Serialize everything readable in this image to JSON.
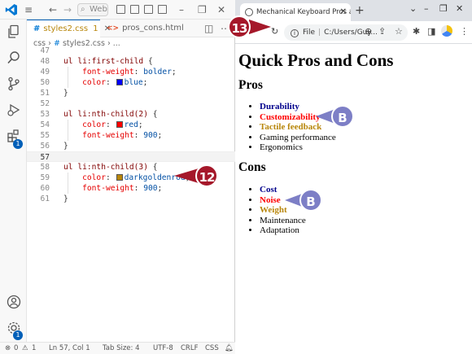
{
  "vscode": {
    "search_text": "Web...",
    "tabs": [
      {
        "icon": "#",
        "label": "styles2.css",
        "count": "1"
      },
      {
        "icon": "<>",
        "label": "pros_cons.html"
      }
    ],
    "breadcrumb": [
      "css",
      "#",
      "styles2.css",
      "..."
    ],
    "code_lines": [
      {
        "num": "47",
        "text": ""
      },
      {
        "num": "48",
        "selector": "ul li:first-child",
        "brace": " {"
      },
      {
        "num": "49",
        "prop": "font-weight",
        "value": "bolder"
      },
      {
        "num": "50",
        "prop": "color",
        "value": "blue",
        "swatch": "#0000ff"
      },
      {
        "num": "51",
        "close": "}"
      },
      {
        "num": "52",
        "text": ""
      },
      {
        "num": "53",
        "selector": "ul li:nth-child(2)",
        "brace": " {"
      },
      {
        "num": "54",
        "prop": "color",
        "value": "red",
        "swatch": "#ff0000"
      },
      {
        "num": "55",
        "prop": "font-weight",
        "value": "900"
      },
      {
        "num": "56",
        "close": "}"
      },
      {
        "num": "57",
        "text": ""
      },
      {
        "num": "58",
        "selector": "ul li:nth-child(3)",
        "brace": " {"
      },
      {
        "num": "59",
        "prop": "color",
        "value": "darkgoldenrod",
        "swatch": "#b8860b"
      },
      {
        "num": "60",
        "prop": "font-weight",
        "value": "900"
      },
      {
        "num": "61",
        "close": "}"
      }
    ],
    "explorer_badge": "1",
    "settings_badge": "1",
    "status": {
      "errors": "0",
      "warnings": "1",
      "position": "Ln 57, Col 1",
      "tab_size": "Tab Size: 4",
      "encoding": "UTF-8",
      "eol": "CRLF",
      "language": "CSS"
    }
  },
  "browser": {
    "tab_title": "Mechanical Keyboard Pros and Cons",
    "address_label": "File",
    "address_text": "C:/Users/Guy...",
    "page": {
      "title": "Quick Pros and Cons",
      "pros_heading": "Pros",
      "pros": [
        "Durability",
        "Customizability",
        "Tactile feedback",
        "Gaming performance",
        "Ergonomics"
      ],
      "cons_heading": "Cons",
      "cons": [
        "Cost",
        "Noise",
        "Weight",
        "Maintenance",
        "Adaptation"
      ]
    }
  },
  "callouts": {
    "step_12": "12",
    "step_13": "13",
    "b_label": "B"
  },
  "colors": {
    "accent_blue": "#005fb8",
    "callout_red": "#a5182a",
    "callout_purple": "#7d7fc6",
    "li_first": "#00008b",
    "li_second": "#ff0000",
    "li_third": "#b8860b"
  }
}
